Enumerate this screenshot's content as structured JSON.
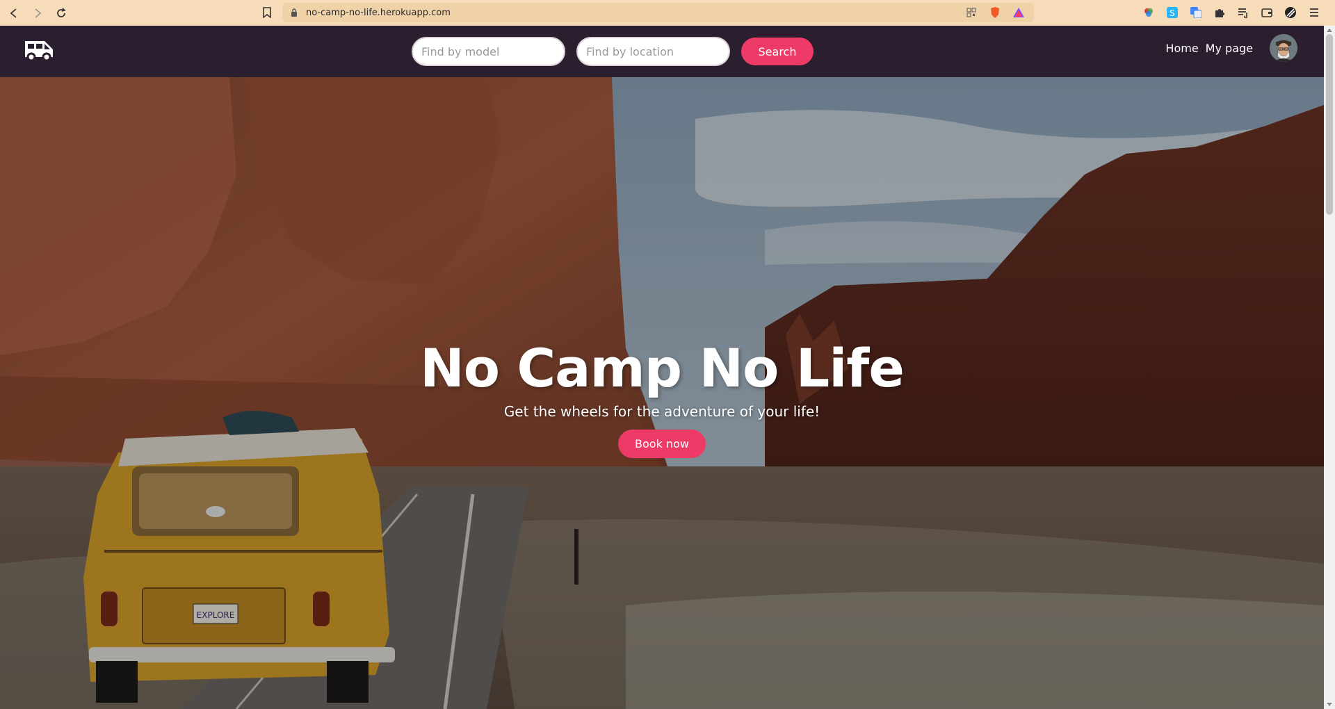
{
  "browser": {
    "url": "no-camp-no-life.herokuapp.com"
  },
  "navbar": {
    "model_placeholder": "Find by model",
    "location_placeholder": "Find by location",
    "search_label": "Search",
    "links": [
      "Home",
      "My page"
    ]
  },
  "hero": {
    "title": "No Camp No Life",
    "subtitle": "Get the wheels for the adventure of your life!",
    "cta_label": "Book now",
    "van_plate": "EXPLORE"
  },
  "colors": {
    "accent": "#ee3a67",
    "navbar": "#2b1e2e",
    "chrome": "#f6dcb8"
  }
}
